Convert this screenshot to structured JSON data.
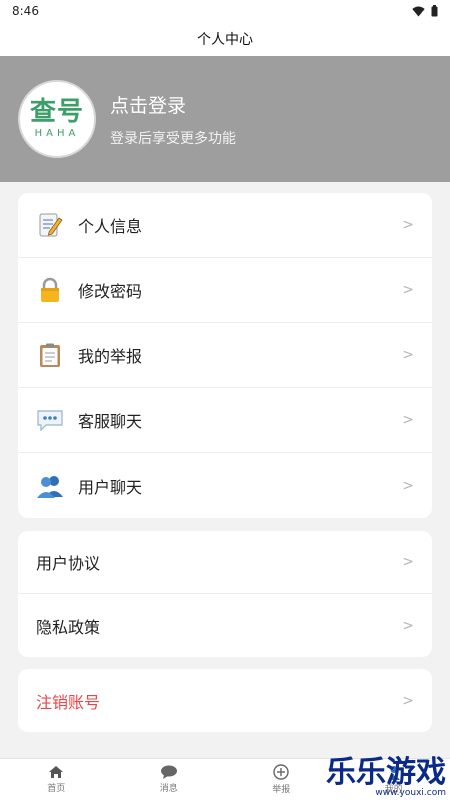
{
  "status_bar": {
    "time": "8:46"
  },
  "header": {
    "title": "个人中心"
  },
  "profile": {
    "avatar_main": "查号",
    "avatar_sub": "HAHA",
    "login_title": "点击登录",
    "login_subtitle": "登录后享受更多功能"
  },
  "menu_main": [
    {
      "label": "个人信息",
      "icon": "memo-icon"
    },
    {
      "label": "修改密码",
      "icon": "lock-icon"
    },
    {
      "label": "我的举报",
      "icon": "clipboard-icon"
    },
    {
      "label": "客服聊天",
      "icon": "speech-bubble-icon"
    },
    {
      "label": "用户聊天",
      "icon": "users-icon"
    }
  ],
  "menu_legal": [
    {
      "label": "用户协议"
    },
    {
      "label": "隐私政策"
    }
  ],
  "menu_account": [
    {
      "label": "注销账号"
    }
  ],
  "chevron": ">",
  "tabs": [
    {
      "label": "首页",
      "icon": "home-icon"
    },
    {
      "label": "消息",
      "icon": "chat-icon"
    },
    {
      "label": "举报",
      "icon": "plus-circle-icon"
    },
    {
      "label": "我的",
      "icon": "user-icon"
    }
  ],
  "watermark": {
    "main": "乐乐游戏",
    "sub": "www.youxi.com"
  },
  "colors": {
    "profile_bg": "#9e9e9e",
    "danger": "#e8474a",
    "avatar_green": "#3e9e6a",
    "watermark": "#0b2a88"
  }
}
